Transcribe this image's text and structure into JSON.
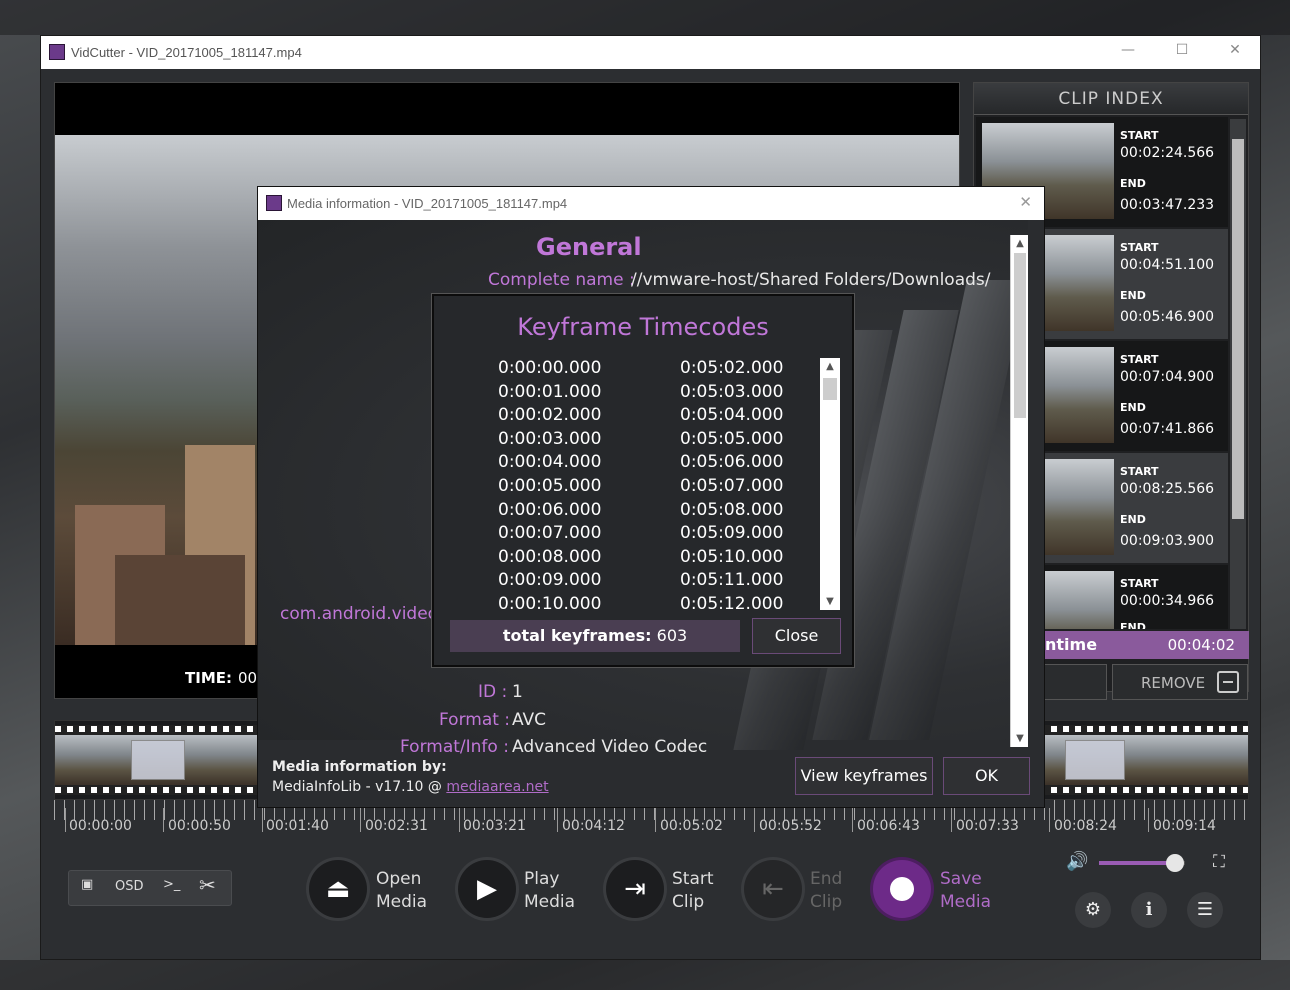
{
  "window": {
    "title": "VidCutter - VID_20171005_181147.mp4",
    "controls": {
      "minimize": "—",
      "maximize": "☐",
      "close": "✕"
    }
  },
  "player": {
    "time_label": "TIME:",
    "time_value": "00"
  },
  "clip_index": {
    "title": "CLIP INDEX",
    "start_label": "START",
    "end_label": "END",
    "clips": [
      {
        "start": "00:02:24.566",
        "end": "00:03:47.233"
      },
      {
        "start": "00:04:51.100",
        "end": "00:05:46.900"
      },
      {
        "start": "00:07:04.900",
        "end": "00:07:41.866"
      },
      {
        "start": "00:08:25.566",
        "end": "00:09:03.900"
      },
      {
        "start": "00:00:34.966",
        "end": "END"
      }
    ],
    "runtime_label": "ntime",
    "runtime_value": "00:04:02",
    "remove_label": "REMOVE"
  },
  "timeline": {
    "labels": [
      "00:00:00",
      "00:00:50",
      "00:01:40",
      "00:02:31",
      "00:03:21",
      "00:04:12",
      "00:05:02",
      "00:05:52",
      "00:06:43",
      "00:07:33",
      "00:08:24",
      "00:09:14"
    ]
  },
  "toolbar": {
    "group": {
      "screenshot": "▣",
      "osd": "OSD",
      "console": ">_",
      "cut": "✂"
    },
    "open": [
      "Open",
      "Media"
    ],
    "play": [
      "Play",
      "Media"
    ],
    "start_clip": [
      "Start",
      "Clip"
    ],
    "end_clip": [
      "End",
      "Clip"
    ],
    "save": [
      "Save",
      "Media"
    ],
    "volume_level": 0.88,
    "icons": {
      "volume": "🔊",
      "fullscreen": "⛶",
      "settings": "⚙",
      "info": "i",
      "menu": "☰"
    }
  },
  "media_info": {
    "title": "Media information - VID_20171005_181147.mp4",
    "section": "General",
    "complete_name_key": "Complete name :",
    "complete_name_value": "//vmware-host/Shared Folders/Downloads/",
    "android_value": "com.android.video",
    "id_key": "ID :",
    "id_value": "1",
    "format_key": "Format :",
    "format_value": "AVC",
    "format_info_key": "Format/Info :",
    "format_info_value": "Advanced Video Codec",
    "footer_title": "Media information by:",
    "footer_lib": "MediaInfoLib - v17.10 @ ",
    "footer_link": "mediaarea.net",
    "view_keyframes": "View keyframes",
    "ok": "OK"
  },
  "keyframes": {
    "title": "Keyframe Timecodes",
    "col1": [
      "0:00:00.000",
      "0:00:01.000",
      "0:00:02.000",
      "0:00:03.000",
      "0:00:04.000",
      "0:00:05.000",
      "0:00:06.000",
      "0:00:07.000",
      "0:00:08.000",
      "0:00:09.000",
      "0:00:10.000"
    ],
    "col2": [
      "0:05:02.000",
      "0:05:03.000",
      "0:05:04.000",
      "0:05:05.000",
      "0:05:06.000",
      "0:05:07.000",
      "0:05:08.000",
      "0:05:09.000",
      "0:05:10.000",
      "0:05:11.000",
      "0:05:12.000"
    ],
    "total_label": "total keyframes:",
    "total_value": "603",
    "close": "Close"
  }
}
